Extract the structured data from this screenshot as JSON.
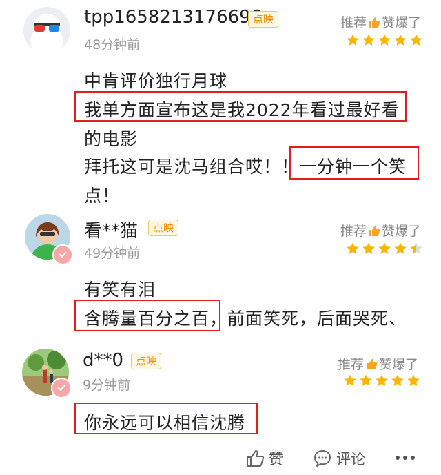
{
  "verdict_prefix": "推荐",
  "verdict_suffix": "赞爆了",
  "reviews": [
    {
      "username": "tpp1658213176696",
      "badge": "点映",
      "time": "48分钟前",
      "rating": 5,
      "lines": [
        "中肯评价独行月球",
        "我单方面宣布这是我2022年看过最好看",
        "的电影",
        "拜托这可是沈马组合哎！！一分钟一个笑",
        "点！"
      ]
    },
    {
      "username": "看**猫",
      "badge": "点映",
      "time": "49分钟前",
      "rating": 4.5,
      "lines": [
        "有笑有泪",
        "含腾量百分之百，前面笑死，后面哭死、"
      ]
    },
    {
      "username": "d**0",
      "badge": "点映",
      "time": "9分钟前",
      "rating": 5,
      "lines": [
        "你永远可以相信沈腾"
      ]
    }
  ],
  "footer": {
    "like_label": "赞",
    "comment_label": "评论"
  },
  "colors": {
    "highlight": "#e02020",
    "star": "#ffb400",
    "badge": "#f08c00"
  }
}
